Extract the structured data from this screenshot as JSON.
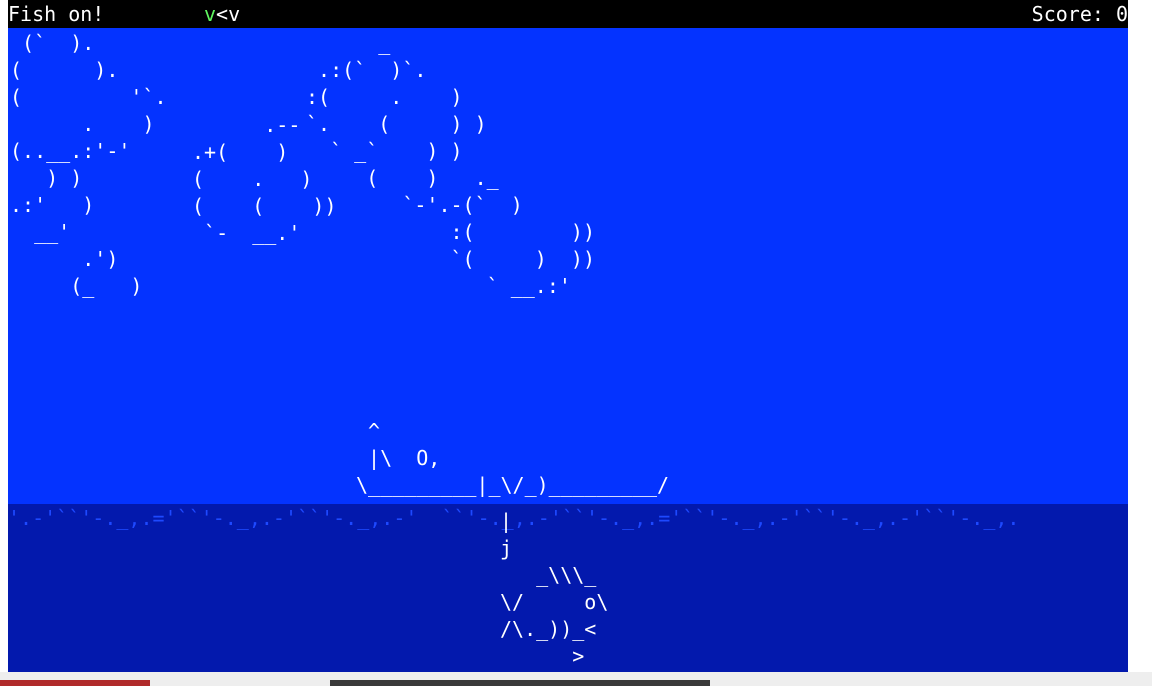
{
  "status": {
    "left_text": "Fish on!",
    "indicator_green": "v",
    "indicator_rest": "<v",
    "score_text": "Score: 0"
  },
  "colors": {
    "sky": "#0433ff",
    "sea": "#0319ad",
    "bar": "#000000",
    "indicator": "#5ff55f",
    "waves": "#1e49ff"
  },
  "clouds": {
    "left": " (`  ).\n(      ).\n(         '`.\n      .    )\n(..__.:'-'\n   ) )\n.:'   )\n  __'\n      .')\n     (_   )",
    "middle": "      .--\n.+(    )\n(    .   )\n(    (    ))\n `-  __.'",
    "right": "      _\n .:(`  )`.\n:(     .    )\n`.    (     ) )\n  ` _`    ) )\n     (    )   ._\n        `-'.-(`  )\n            :(        ))\n            `(     )  ))\n               ` __.:'"
  },
  "boat": " ^\n |\\  O,\n\\_________|_\\/_)_________/",
  "waves": "'.-'``'-._,.='``'-._,.-'``'-._,.-'  ``'-._,.-'``'-._,.='``'-._,.-'``'-._,.-'``'-._,.",
  "line": "|\nj",
  "fish": "   _\\\\\\_\n\\/     o\\\n/\\._))_<\n      >"
}
